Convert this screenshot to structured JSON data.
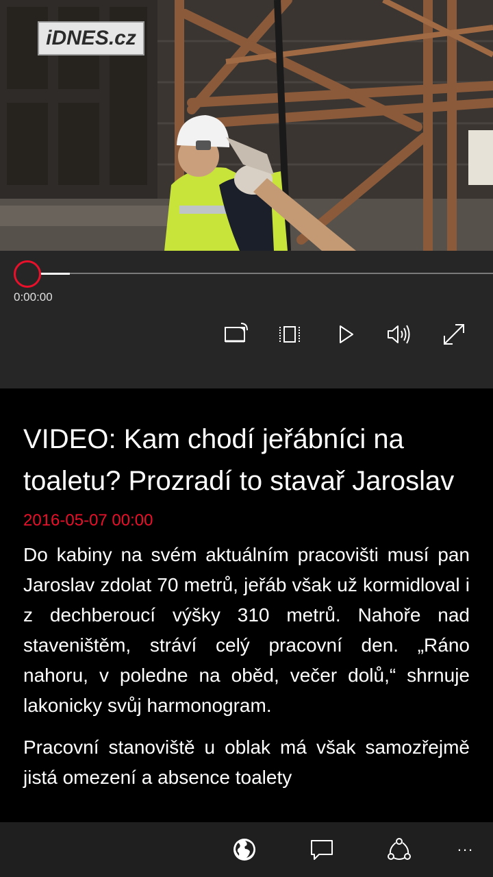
{
  "video": {
    "watermark": "iDNES.cz",
    "current_time": "0:00:00",
    "progress": 0
  },
  "player_controls": {
    "cast_icon": "cast-icon",
    "aspect_icon": "aspect-ratio-icon",
    "play_icon": "play-icon",
    "volume_icon": "volume-icon",
    "fullscreen_icon": "fullscreen-icon"
  },
  "article": {
    "headline": "VIDEO: Kam chodí jeřábníci na toaletu? Prozradí to stavař Jaroslav",
    "date": "2016-05-07 00:00",
    "paragraphs": [
      "Do kabiny na svém aktuálním pracovišti musí pan Jaroslav zdolat 70 metrů, jeřáb však už kormidloval i z dechberoucí výšky 310 metrů. Nahoře nad staveništěm, stráví celý pracovní den. „Ráno nahoru, v poledne na oběd, večer dolů,“ shrnuje lakonicky svůj harmonogram.",
      "Pracovní stanoviště u oblak má však samozřejmě jistá omezení a absence toalety"
    ]
  },
  "appbar": {
    "globe_icon": "globe-icon",
    "comment_icon": "comment-icon",
    "share_icon": "share-icon",
    "more_label": "..."
  },
  "colors": {
    "accent": "#e8102a",
    "controls_bg": "#262626",
    "appbar_bg": "#1f1f1f",
    "page_bg": "#000000"
  }
}
